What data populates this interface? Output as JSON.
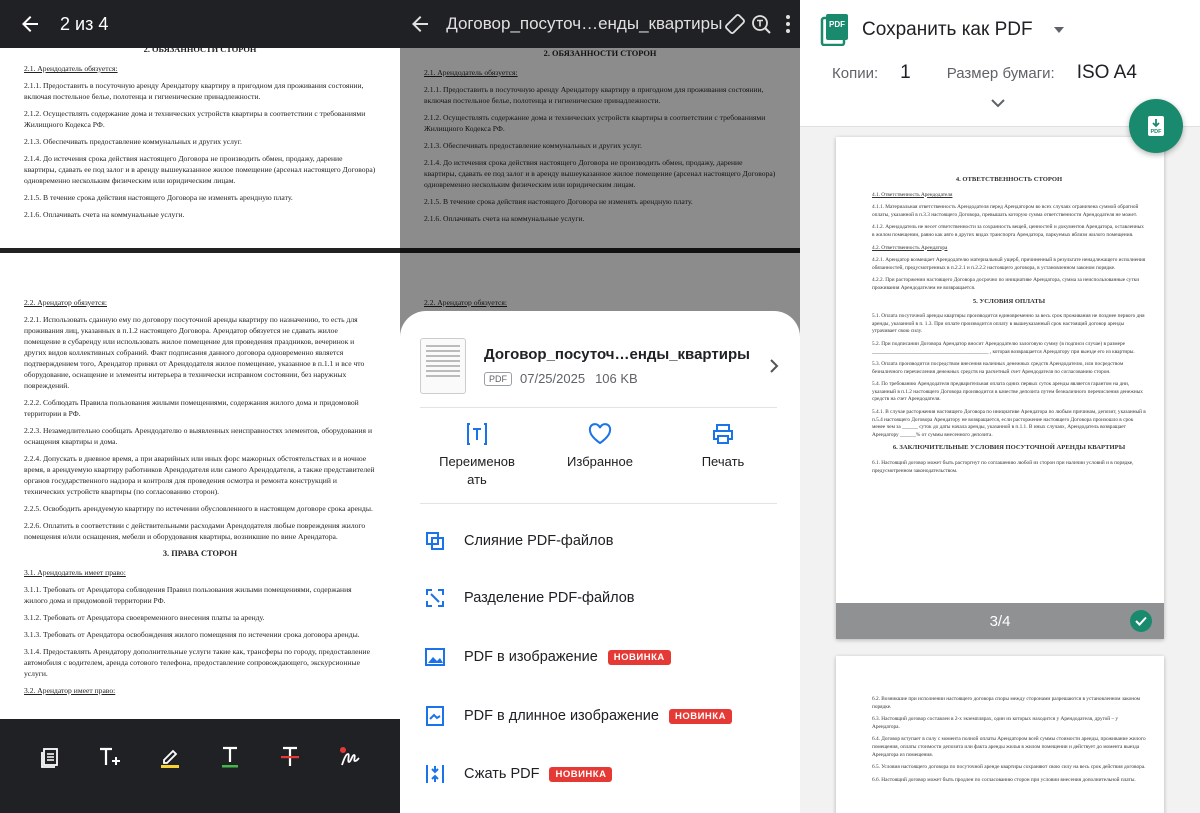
{
  "colors": {
    "accent_blue": "#1a73e8",
    "accent_green": "#1a8a6e",
    "badge_red": "#e53935",
    "toolbar_dark": "#202124"
  },
  "viewer": {
    "page_counter": "2 из 4",
    "page1": {
      "heading": "2. ОБЯЗАННОСТИ СТОРОН",
      "subheading": "2.1. Арендодатель обязуется:",
      "paragraphs": [
        "2.1.1. Предоставить в посуточную аренду Арендатору квартиру в пригодном для проживания состоянии, включая постельное белье, полотенца и гигиенические принадлежности.",
        "2.1.2. Осуществлять содержание дома и технических устройств квартиры в соответствии с требованиями Жилищного Кодекса РФ.",
        "2.1.3. Обеспечивать предоставление коммунальных и других услуг.",
        "2.1.4. До истечения срока действия настоящего Договора не производить обмен, продажу, дарение квартиры, сдавать ее под залог и в аренду вышеуказанное жилое помещение (арсенал настоящего Договора) одновременно нескольким физическим или юридическим лицам.",
        "2.1.5. В течение срока действия настоящего Договора не изменять арендную плату.",
        "2.1.6. Оплачивать счета на коммунальные услуги."
      ]
    },
    "page2": {
      "subheading": "2.2. Арендатор обязуется:",
      "paragraphs": [
        "2.2.1. Использовать сданную ему по договору посуточной аренды квартиру по назначению, то есть для проживания лиц, указанных в п.1.2 настоящего Договора. Арендатор обязуется не сдавать жилое помещение в субаренду или использовать жилое помещение для проведения праздников, вечеринок и других видов коллективных собраний. Факт подписания данного договора одновременно является подтверждением того, Арендатор принял от Арендодателя жилое помещение, указанное в п.1.1 и все что оборудование, оснащение и элементы интерьера в технически исправном состоянии, без наружных повреждений.",
        "2.2.2. Соблюдать Правила пользования жилыми помещениями, содержания жилого дома и придомовой территории в РФ.",
        "2.2.3. Незамедлительно сообщать Арендодателю о выявленных неисправностях элементов, оборудования и оснащения квартиры и дома.",
        "2.2.4. Допускать в дневное время, а при аварийных или иных форс мажорных обстоятельствах и в ночное время, в арендуемую квартиру работников Арендодателя или самого Арендодателя, а также представителей органов государственного надзора и контроля для проведения осмотра и ремонта конструкций и технических устройств квартиры (по согласованию сторон).",
        "2.2.5. Освободить арендуемую квартиру по истечении обусловленного в настоящем договоре срока аренды.",
        "2.2.6. Оплатить в соответствии с действительными расходами Арендодателя любые повреждения жилого помещения и/или оснащения, мебели и оборудования квартиры, возникшие по вине Арендатора."
      ],
      "heading2": "3. ПРАВА СТОРОН",
      "subheading2": "3.1. Арендодатель имеет право:",
      "paragraphs2": [
        "3.1.1. Требовать от Арендатора соблюдения Правил пользования жилыми помещениями, содержания жилого дома и придомовой территории РФ.",
        "3.1.2. Требовать от Арендатора своевременного внесения платы за аренду.",
        "3.1.3. Требовать от Арендатора освобождения жилого помещения по истечении срока договора аренды.",
        "3.1.4. Предоставлять Арендатору дополнительные услуги такие как, трансферы по городу, предоставление автомобиля с водителем, аренда сотового телефона, предоставление сопровождающего, экскурсионные услуги."
      ],
      "subheading3": "3.2. Арендатор имеет право:"
    },
    "sheet_tail_subheading": "2.2. Арендатор обязуется:"
  },
  "actions_sheet": {
    "doc_title": "Договор_посуточ…енды_квартиры",
    "file": {
      "name": "Договор_посуточ…енды_квартиры",
      "type": "PDF",
      "date": "07/25/2025",
      "size": "106 KB"
    },
    "quick_actions": [
      {
        "label": "Переименовать",
        "icon": "rename-icon"
      },
      {
        "label": "Избранное",
        "icon": "heart-icon"
      },
      {
        "label": "Печать",
        "icon": "print-icon"
      }
    ],
    "rename_line1": "Переименов",
    "rename_line2": "ать",
    "menu": [
      {
        "label": "Слияние PDF-файлов",
        "badge": ""
      },
      {
        "label": "Разделение PDF-файлов",
        "badge": ""
      },
      {
        "label": "PDF в изображение",
        "badge": "НОВИНКА"
      },
      {
        "label": "PDF в длинное изображение",
        "badge": "НОВИНКА"
      },
      {
        "label": "Сжать PDF",
        "badge": "НОВИНКА"
      }
    ]
  },
  "print": {
    "title": "Сохранить как PDF",
    "copies_label": "Копии:",
    "copies_value": "1",
    "paper_label": "Размер бумаги:",
    "paper_value": "ISO A4",
    "page_indicator": "3/4",
    "page3": {
      "heading": "4. ОТВЕТСТВЕННОСТЬ СТОРОН",
      "sub1": "4.1. Ответственность Арендодателя",
      "p1": [
        "4.1.1. Материальная ответственность Арендодателя перед Арендатором во всех случаях ограничена суммой обратной оплаты, указанной в п.3.3 настоящего Договора, превышать которую сумма ответственности Арендодателя не может.",
        "4.1.2. Арендодатель не несет ответственности за сохранность вещей, ценностей и документов Арендатора, оставленных в жилом помещении, равно как авто в других видах транспорта Арендатора, паркуемых вблизи жилого помещения."
      ],
      "sub2": "4.2. Ответственность Арендатора",
      "p2": [
        "4.2.1. Арендатор возмещает Арендодателю материальный ущерб, причиненный в результате ненадлежащего исполнения обязанностей, предусмотренных в п.2.2.1 и п.2.2.2 настоящего договора, в установленном законом порядке.",
        "4.2.2. При расторжении настоящего Договора досрочно по инициативе Арендатора, сумма за неиспользованные сутки проживания Арендодателем не возвращается."
      ],
      "heading2": "5. УСЛОВИЯ ОПЛАТЫ",
      "p3": [
        "5.1. Оплата посуточной аренды квартиры производится единовременно за весь срок проживания не позднее первого дня аренды, указанной в п. 1.3. При оплате производится оплату в вышеуказанный срок настоящий договор аренды утрачивает свою силу.",
        "5.2. При подписании Договора Арендатор вносит Арендодателю залоговую сумму (в подписи случае) в размере ____________________________________________ , которая возвращается Арендатору при выезде его из квартиры.",
        "5.3. Оплата производится посредством внесения наличных денежных средств Арендодателю, или посредством безналичного перечисления денежных средств на расчетный счет Арендодателя по согласованию сторон.",
        "5.4. По требованию Арендодателя предварительная оплата одних первых суток аренды является гарантом на дни, указанный в п.1.2 настоящего Договора производится в качестве депозита путем безналичного перечисления денежных средств на счет Арендодателя.",
        "5.4.1. В случае расторжения настоящего Договора по инициативе Арендатора по любым причинам, депозит, указанный в п.5.4 настоящего Договора Арендатору не возвращается, если расторжение настоящего Договора произошло в срок менее чем за ______ суток до даты начала аренды, указанной в п.1.1. В иных случаях, Арендодатель возвращает Арендатору ______% от суммы внесенного депозита."
      ],
      "heading3": "6. ЗАКЛЮЧИТЕЛЬНЫЕ УСЛОВИЯ ПОСУТОЧНОЙ АРЕНДЫ КВАРТИРЫ",
      "p4": [
        "6.1. Настоящий договор может быть расторгнут по соглашению любой из сторон при наличии условий и в порядке, предусмотренном законодательством."
      ]
    },
    "page4": {
      "p": [
        "6.2. Возникшие при исполнении настоящего договора споры между сторонами разрешаются в установленном законом порядке.",
        "6.3. Настоящий договор составлен в 2-х экземплярах, один из которых находится у Арендодателя, другой – у Арендатора.",
        "6.4. Договор вступает в силу с момента полной оплаты Арендатором всей суммы стоимости аренды, проживание жилого помещения, оплаты стоимости депозита или факта аренды жилья в жилом помещении и действует до момента выезда Арендатора из помещения.",
        "6.5. Условия настоящего договора по посуточной аренде квартиры сохраняют свою силу на весь срок действия договора.",
        "6.6. Настоящий договор может быть продлен по согласованию сторон при условии внесения дополнительной платы."
      ]
    }
  }
}
